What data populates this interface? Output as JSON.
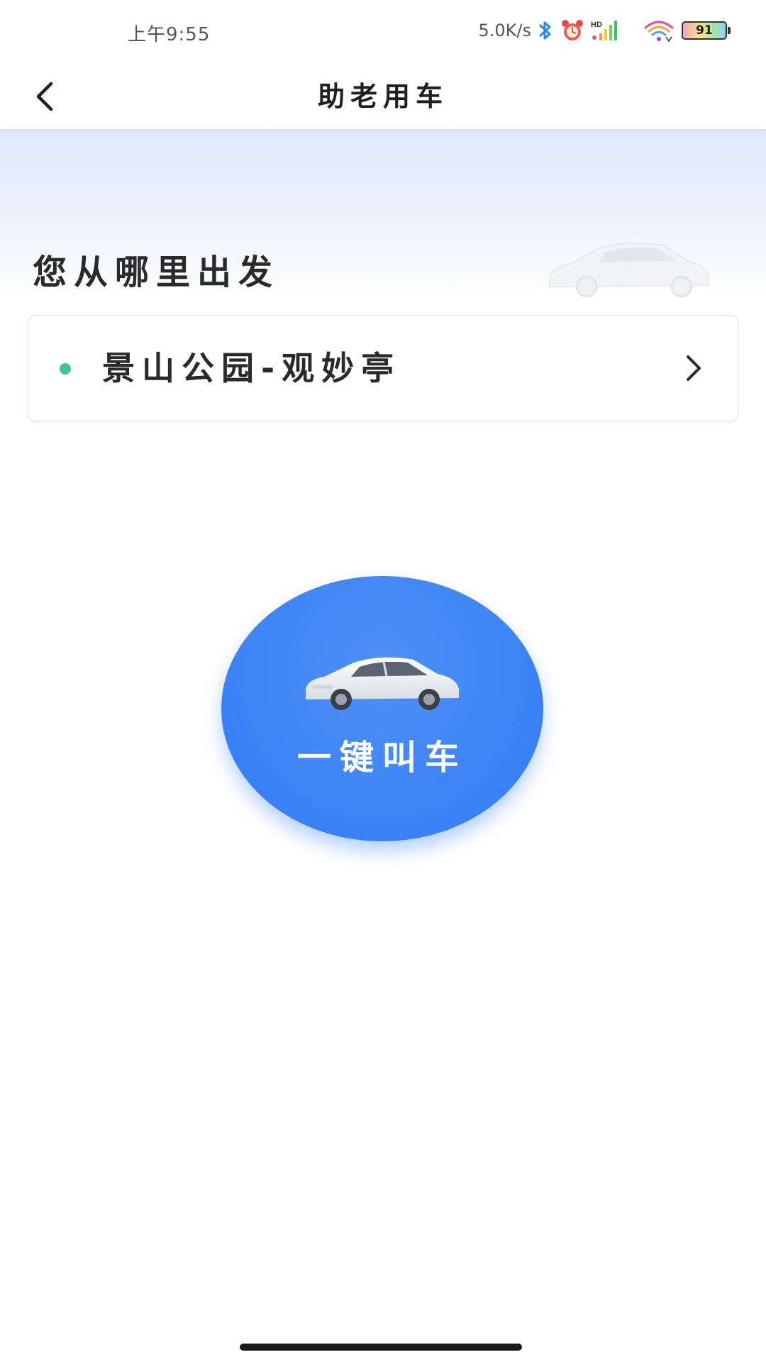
{
  "status_bar": {
    "time": "上午9:55",
    "net_speed": "5.0K/s",
    "battery_level": "91",
    "icons": [
      "bluetooth-icon",
      "alarm-icon",
      "hd-signal-icon",
      "wifi-icon",
      "battery-icon"
    ]
  },
  "nav": {
    "title": "助老用车",
    "back_icon": "chevron-left-icon"
  },
  "hero": {
    "title": "您从哪里出发",
    "decoration_icon": "car-icon"
  },
  "location": {
    "text": "景山公园-观妙亭",
    "dot_color": "#43c68a",
    "chevron_icon": "chevron-right-icon"
  },
  "call_button": {
    "label": "一键叫车",
    "color": "#3e84f7",
    "icon": "car-icon"
  }
}
